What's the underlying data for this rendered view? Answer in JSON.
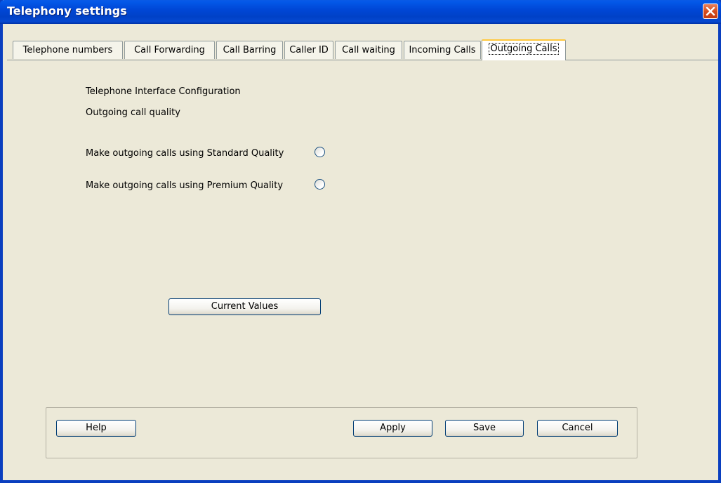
{
  "window": {
    "title": "Telephony settings",
    "close_icon": "close-x-icon",
    "titlebar_color": "#0047d6",
    "close_color": "#d64d1e"
  },
  "tabs": [
    {
      "label": "Telephone numbers",
      "active": false
    },
    {
      "label": "Call Forwarding",
      "active": false
    },
    {
      "label": "Call Barring",
      "active": false
    },
    {
      "label": "Caller ID",
      "active": false
    },
    {
      "label": "Call waiting",
      "active": false
    },
    {
      "label": "Incoming Calls",
      "active": false
    },
    {
      "label": "Outgoing Calls",
      "active": true
    }
  ],
  "content": {
    "heading": "Telephone Interface Configuration",
    "subheading": "Outgoing call quality",
    "options": [
      {
        "label": "Make outgoing calls using Standard Quality",
        "selected": false
      },
      {
        "label": "Make outgoing calls using Premium Quality",
        "selected": false
      }
    ],
    "current_values_label": "Current Values"
  },
  "footer": {
    "help_label": "Help",
    "apply_label": "Apply",
    "save_label": "Save",
    "cancel_label": "Cancel"
  }
}
